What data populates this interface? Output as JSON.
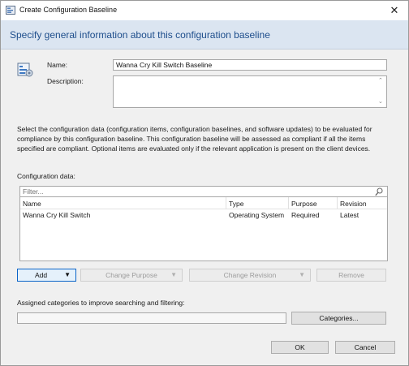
{
  "window": {
    "title": "Create Configuration Baseline",
    "close_glyph": "✕"
  },
  "header": {
    "heading": "Specify general information about this configuration baseline"
  },
  "form": {
    "name_label": "Name:",
    "name_value": "Wanna Cry Kill Switch Baseline",
    "description_label": "Description:",
    "description_value": ""
  },
  "instructions": "Select the configuration data (configuration items, configuration baselines, and software updates) to be evaluated for compliance by this configuration baseline. This configuration baseline will be assessed as compliant if all the items specified are compliant. Optional items are evaluated only if the relevant application is present on  the client devices.",
  "config_data": {
    "label": "Configuration data:",
    "filter_placeholder": "Filter...",
    "columns": {
      "name": "Name",
      "type": "Type",
      "purpose": "Purpose",
      "revision": "Revision"
    },
    "rows": [
      {
        "name": "Wanna Cry Kill Switch",
        "type": "Operating System",
        "purpose": "Required",
        "revision": "Latest"
      }
    ]
  },
  "buttons": {
    "add": "Add",
    "change_purpose": "Change Purpose",
    "change_revision": "Change Revision",
    "remove": "Remove",
    "categories": "Categories...",
    "ok": "OK",
    "cancel": "Cancel"
  },
  "categories": {
    "label": "Assigned categories to improve searching and filtering:",
    "value": ""
  },
  "icons": {
    "app": "baseline-app-icon",
    "baseline": "configuration-baseline-icon",
    "search": "search-icon",
    "dropdown": "dropdown-arrow-icon"
  },
  "colors": {
    "header_bg": "#dbe5f1",
    "heading_text": "#1e4e8c",
    "content_bg": "#f0f0f0",
    "primary_border": "#0a64c8"
  }
}
